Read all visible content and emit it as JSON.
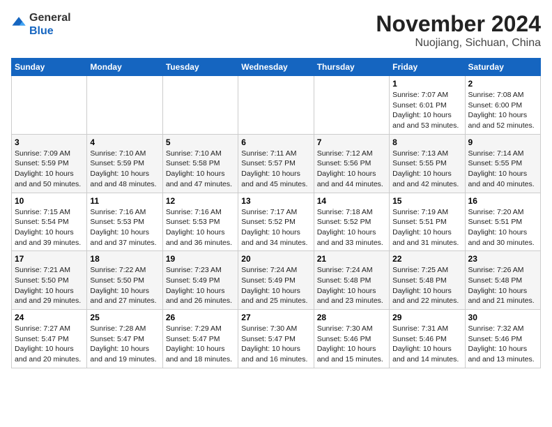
{
  "header": {
    "logo": {
      "line1": "General",
      "line2": "Blue"
    },
    "title": "November 2024",
    "location": "Nuojiang, Sichuan, China"
  },
  "calendar": {
    "weekdays": [
      "Sunday",
      "Monday",
      "Tuesday",
      "Wednesday",
      "Thursday",
      "Friday",
      "Saturday"
    ],
    "rows": [
      [
        {
          "day": "",
          "info": ""
        },
        {
          "day": "",
          "info": ""
        },
        {
          "day": "",
          "info": ""
        },
        {
          "day": "",
          "info": ""
        },
        {
          "day": "",
          "info": ""
        },
        {
          "day": "1",
          "info": "Sunrise: 7:07 AM\nSunset: 6:01 PM\nDaylight: 10 hours and 53 minutes."
        },
        {
          "day": "2",
          "info": "Sunrise: 7:08 AM\nSunset: 6:00 PM\nDaylight: 10 hours and 52 minutes."
        }
      ],
      [
        {
          "day": "3",
          "info": "Sunrise: 7:09 AM\nSunset: 5:59 PM\nDaylight: 10 hours and 50 minutes."
        },
        {
          "day": "4",
          "info": "Sunrise: 7:10 AM\nSunset: 5:59 PM\nDaylight: 10 hours and 48 minutes."
        },
        {
          "day": "5",
          "info": "Sunrise: 7:10 AM\nSunset: 5:58 PM\nDaylight: 10 hours and 47 minutes."
        },
        {
          "day": "6",
          "info": "Sunrise: 7:11 AM\nSunset: 5:57 PM\nDaylight: 10 hours and 45 minutes."
        },
        {
          "day": "7",
          "info": "Sunrise: 7:12 AM\nSunset: 5:56 PM\nDaylight: 10 hours and 44 minutes."
        },
        {
          "day": "8",
          "info": "Sunrise: 7:13 AM\nSunset: 5:55 PM\nDaylight: 10 hours and 42 minutes."
        },
        {
          "day": "9",
          "info": "Sunrise: 7:14 AM\nSunset: 5:55 PM\nDaylight: 10 hours and 40 minutes."
        }
      ],
      [
        {
          "day": "10",
          "info": "Sunrise: 7:15 AM\nSunset: 5:54 PM\nDaylight: 10 hours and 39 minutes."
        },
        {
          "day": "11",
          "info": "Sunrise: 7:16 AM\nSunset: 5:53 PM\nDaylight: 10 hours and 37 minutes."
        },
        {
          "day": "12",
          "info": "Sunrise: 7:16 AM\nSunset: 5:53 PM\nDaylight: 10 hours and 36 minutes."
        },
        {
          "day": "13",
          "info": "Sunrise: 7:17 AM\nSunset: 5:52 PM\nDaylight: 10 hours and 34 minutes."
        },
        {
          "day": "14",
          "info": "Sunrise: 7:18 AM\nSunset: 5:52 PM\nDaylight: 10 hours and 33 minutes."
        },
        {
          "day": "15",
          "info": "Sunrise: 7:19 AM\nSunset: 5:51 PM\nDaylight: 10 hours and 31 minutes."
        },
        {
          "day": "16",
          "info": "Sunrise: 7:20 AM\nSunset: 5:51 PM\nDaylight: 10 hours and 30 minutes."
        }
      ],
      [
        {
          "day": "17",
          "info": "Sunrise: 7:21 AM\nSunset: 5:50 PM\nDaylight: 10 hours and 29 minutes."
        },
        {
          "day": "18",
          "info": "Sunrise: 7:22 AM\nSunset: 5:50 PM\nDaylight: 10 hours and 27 minutes."
        },
        {
          "day": "19",
          "info": "Sunrise: 7:23 AM\nSunset: 5:49 PM\nDaylight: 10 hours and 26 minutes."
        },
        {
          "day": "20",
          "info": "Sunrise: 7:24 AM\nSunset: 5:49 PM\nDaylight: 10 hours and 25 minutes."
        },
        {
          "day": "21",
          "info": "Sunrise: 7:24 AM\nSunset: 5:48 PM\nDaylight: 10 hours and 23 minutes."
        },
        {
          "day": "22",
          "info": "Sunrise: 7:25 AM\nSunset: 5:48 PM\nDaylight: 10 hours and 22 minutes."
        },
        {
          "day": "23",
          "info": "Sunrise: 7:26 AM\nSunset: 5:48 PM\nDaylight: 10 hours and 21 minutes."
        }
      ],
      [
        {
          "day": "24",
          "info": "Sunrise: 7:27 AM\nSunset: 5:47 PM\nDaylight: 10 hours and 20 minutes."
        },
        {
          "day": "25",
          "info": "Sunrise: 7:28 AM\nSunset: 5:47 PM\nDaylight: 10 hours and 19 minutes."
        },
        {
          "day": "26",
          "info": "Sunrise: 7:29 AM\nSunset: 5:47 PM\nDaylight: 10 hours and 18 minutes."
        },
        {
          "day": "27",
          "info": "Sunrise: 7:30 AM\nSunset: 5:47 PM\nDaylight: 10 hours and 16 minutes."
        },
        {
          "day": "28",
          "info": "Sunrise: 7:30 AM\nSunset: 5:46 PM\nDaylight: 10 hours and 15 minutes."
        },
        {
          "day": "29",
          "info": "Sunrise: 7:31 AM\nSunset: 5:46 PM\nDaylight: 10 hours and 14 minutes."
        },
        {
          "day": "30",
          "info": "Sunrise: 7:32 AM\nSunset: 5:46 PM\nDaylight: 10 hours and 13 minutes."
        }
      ]
    ]
  }
}
